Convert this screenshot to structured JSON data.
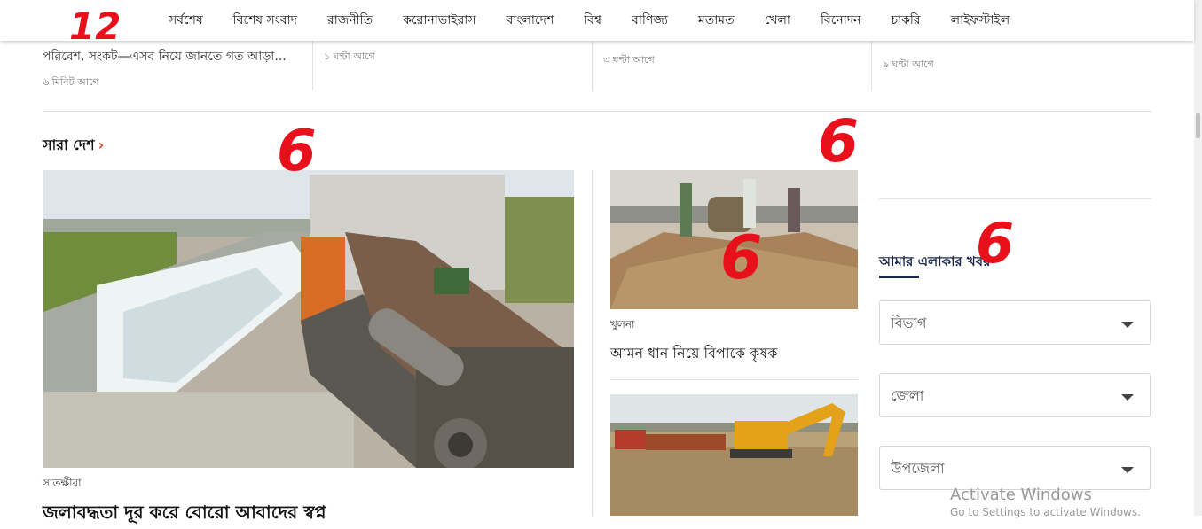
{
  "nav": {
    "items": [
      "সর্বশেষ",
      "বিশেষ সংবাদ",
      "রাজনীতি",
      "করোনাভাইরাস",
      "বাংলাদেশ",
      "বিশ্ব",
      "বাণিজ্য",
      "মতামত",
      "খেলা",
      "বিনোদন",
      "চাকরি",
      "লাইফস্টাইল"
    ]
  },
  "strip": [
    {
      "text": "পরিবেশ, সংকট—এসব নিয়ে জানতে গত আড়া...",
      "time": "৬ মিনিট আগে"
    },
    {
      "text": "",
      "time": "১ ঘণ্টা আগে"
    },
    {
      "text": "",
      "time": "৩ ঘণ্টা আগে"
    },
    {
      "text": "",
      "time": "৯ ঘণ্টা আগে"
    }
  ],
  "section": {
    "title": "সারা দেশ",
    "chevron": "›"
  },
  "main_story": {
    "location": "সাতক্ষীরা",
    "headline": "জলাবদ্ধতা দূর করে বোরো আবাদের স্বপ্ন"
  },
  "side_story": {
    "location": "খুলনা",
    "headline": "আমন ধান নিয়ে বিপাকে কৃষক"
  },
  "area_widget": {
    "title": "আমার এলাকার খবর",
    "dropdowns": [
      "বিভাগ",
      "জেলা",
      "উপজেলা"
    ]
  },
  "annotations": [
    "12",
    "6",
    "6",
    "6",
    "6"
  ],
  "watermark": {
    "line1": "Activate Windows",
    "line2": "Go to Settings to activate Windows."
  }
}
